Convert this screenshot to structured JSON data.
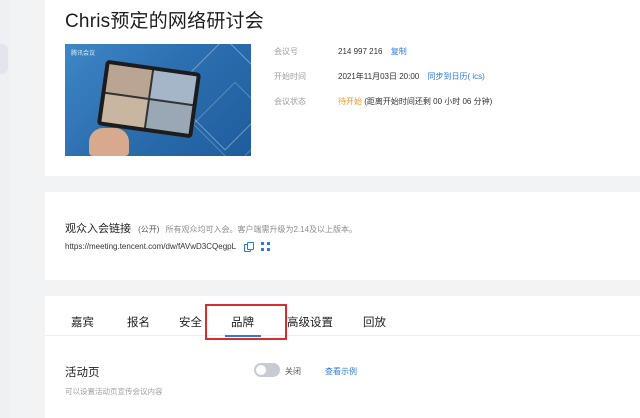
{
  "meeting": {
    "title": "Chris预定的网络研讨会",
    "cover_brand": "腾讯会议",
    "meeting_id_label": "会议号",
    "meeting_id": "214 997 216",
    "copy_label": "复制",
    "start_label": "开始时间",
    "start_time": "2021年11月03日 20:00",
    "sync_label": "同步到日历( ics)",
    "status_label": "会议状态",
    "status": "待开始",
    "countdown": "(距离开始时间还剩 00 小时 06 分钟)"
  },
  "audience_link": {
    "title": "观众入会链接",
    "public_tag": "(公开)",
    "description": "所有观众均可入会。客户端需升级为2.14及以上版本。",
    "url": "https://meeting.tencent.com/dw/fAVwD3CQegpL"
  },
  "tabs": [
    {
      "label": "嘉宾"
    },
    {
      "label": "报名"
    },
    {
      "label": "安全"
    },
    {
      "label": "品牌"
    },
    {
      "label": "高级设置"
    },
    {
      "label": "回放"
    }
  ],
  "active_tab": "品牌",
  "activity_page": {
    "title": "活动页",
    "description": "可以设置活动页宣传会议内容",
    "toggle_label": "关闭",
    "toggle_on": false,
    "view_example": "查看示例"
  },
  "colors": {
    "accent": "#2d7be0",
    "status": "#f0962a",
    "highlight": "#d62d2d"
  }
}
